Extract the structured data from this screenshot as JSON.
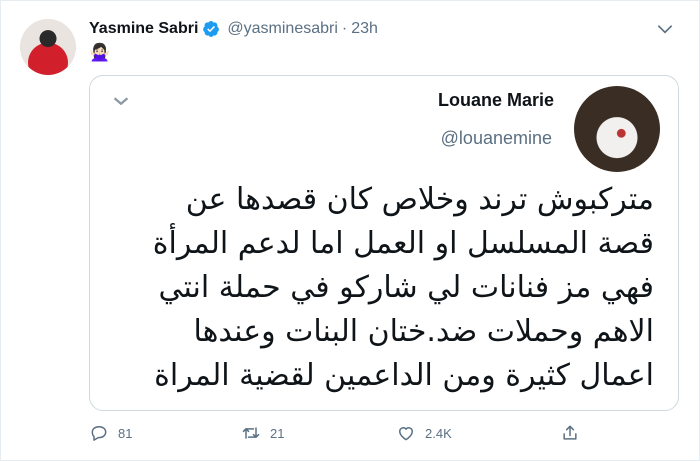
{
  "tweet": {
    "author_name": "Yasmine Sabri",
    "author_handle": "@yasminesabri",
    "separator": "·",
    "time": "23h",
    "body_emoji": "🙅🏻‍♀️",
    "quoted": {
      "author_name": "Louane Marie",
      "author_handle": "@louanemine",
      "lines": [
        "متركبوش ترند وخلاص كان قصدها عن",
        "قصة المسلسل او العمل اما لدعم المرأة",
        "فهي مز فنانات لي شاركو في حملة انتي",
        "الاهم وحملات ضد.ختان البنات وعندها",
        "اعمال كثيرة ومن الداعمين لقضية المراة"
      ]
    },
    "actions": {
      "replies": "81",
      "retweets": "21",
      "likes": "2.4K"
    }
  },
  "colors": {
    "verified_blue": "#1d9bf0",
    "muted_text": "#5b7083",
    "border": "#cfd9de"
  },
  "icons": [
    "verified-badge-icon",
    "chevron-down-icon",
    "reply-icon",
    "retweet-icon",
    "like-icon",
    "share-icon"
  ]
}
